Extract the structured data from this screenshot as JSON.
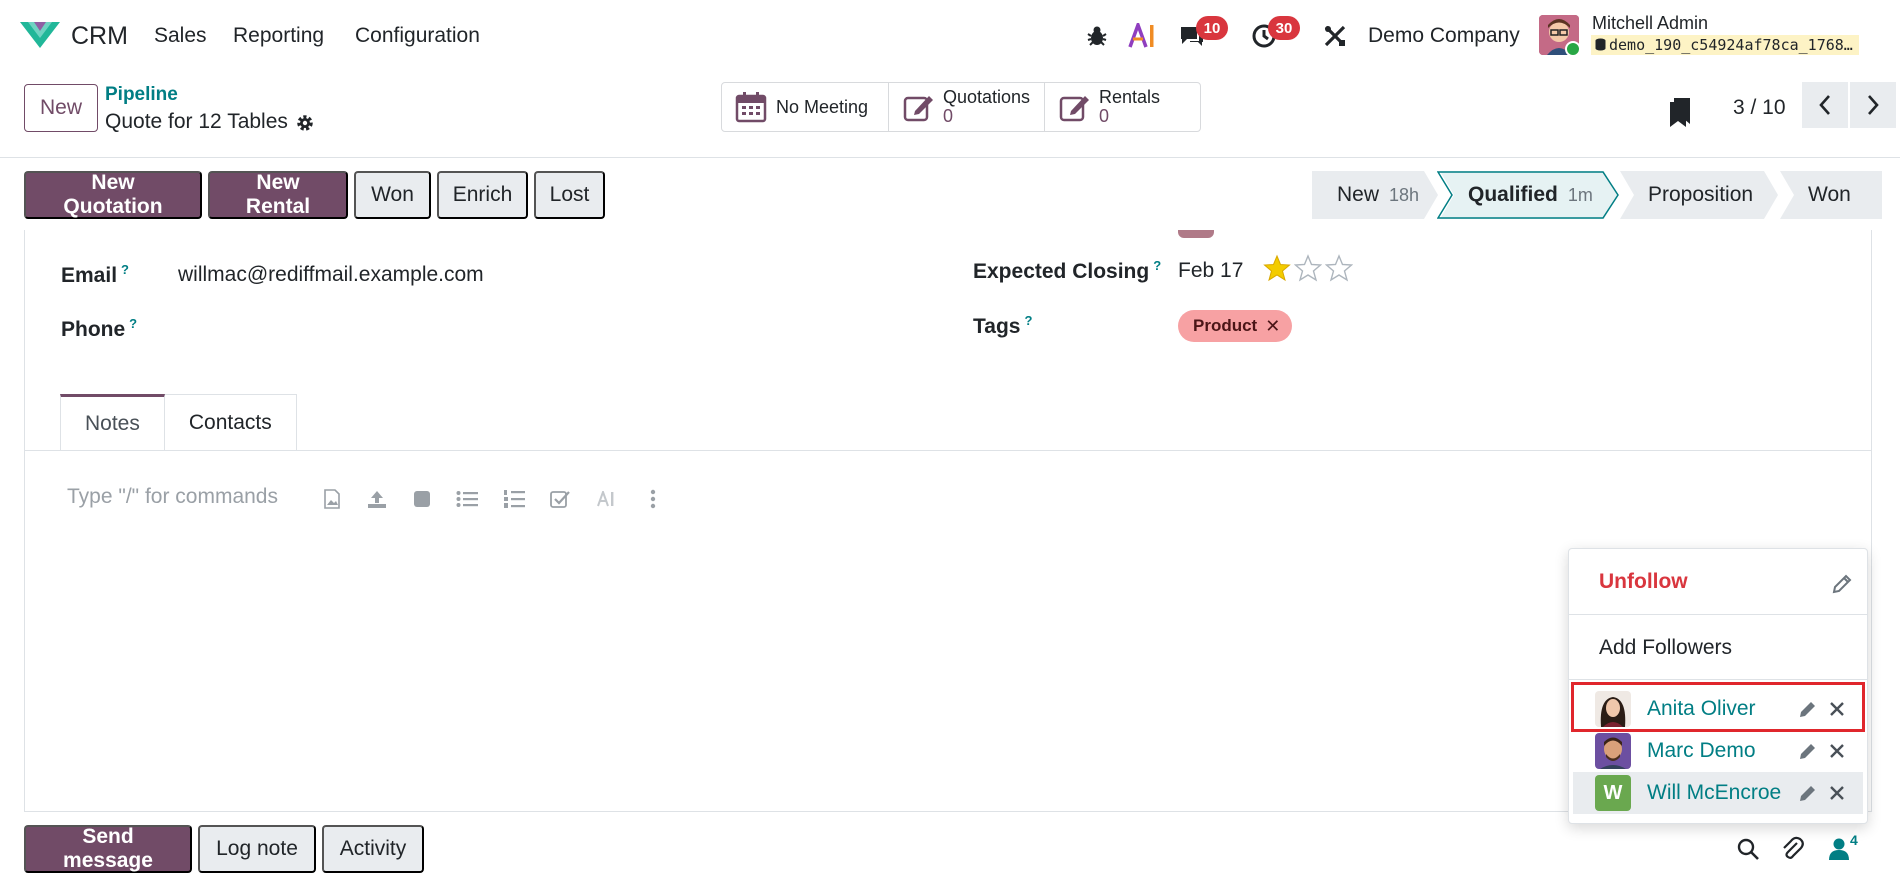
{
  "navbar": {
    "app_name": "CRM",
    "menu": [
      "Sales",
      "Reporting",
      "Configuration"
    ],
    "messages_badge": "10",
    "activities_badge": "30",
    "company": "Demo Company",
    "user_name": "Mitchell Admin",
    "database": "demo_190_c54924af78ca_1768…",
    "icons": [
      "bug-icon",
      "ai-icon",
      "chat-icon",
      "clock-icon",
      "tools-icon"
    ]
  },
  "control": {
    "new_label": "New",
    "breadcrumb": "Pipeline",
    "record_title": "Quote for 12 Tables",
    "stats": [
      {
        "label": "No Meeting",
        "value": "",
        "icon": "calendar-icon"
      },
      {
        "label": "Quotations",
        "value": "0",
        "icon": "edit-icon"
      },
      {
        "label": "Rentals",
        "value": "0",
        "icon": "edit-icon"
      }
    ],
    "pager": "3 / 10"
  },
  "statusbar": {
    "buttons": [
      "New Quotation",
      "New Rental",
      "Won",
      "Enrich",
      "Lost"
    ],
    "stages": [
      {
        "name": "New",
        "duration": "18h"
      },
      {
        "name": "Qualified",
        "duration": "1m"
      },
      {
        "name": "Proposition",
        "duration": ""
      },
      {
        "name": "Won",
        "duration": ""
      }
    ],
    "active_stage": "Qualified"
  },
  "form": {
    "email_label": "Email",
    "email_value": "willmac@rediffmail.example.com",
    "phone_label": "Phone",
    "phone_value": "",
    "closing_label": "Expected Closing",
    "closing_value": "Feb 17",
    "priority": 1,
    "priority_max": 3,
    "tags_label": "Tags",
    "tags": [
      "Product"
    ],
    "help_mark": "?"
  },
  "tabs": [
    "Notes",
    "Contacts"
  ],
  "editor": {
    "placeholder": "Type \"/\" for commands"
  },
  "chatter": {
    "send_message": "Send message",
    "log_note": "Log note",
    "activity": "Activity",
    "followers_count": "4"
  },
  "followers_dropdown": {
    "unfollow": "Unfollow",
    "add_followers": "Add Followers",
    "followers": [
      {
        "name": "Anita Oliver"
      },
      {
        "name": "Marc Demo"
      },
      {
        "name": "Will McEncroe",
        "initial": "W"
      }
    ]
  },
  "colors": {
    "primary": "#714b67",
    "link": "#017e84",
    "danger": "#d9363e",
    "badge": "#d9363e",
    "tag": "#f7a1a3",
    "highlight_box": "#e0262c"
  }
}
